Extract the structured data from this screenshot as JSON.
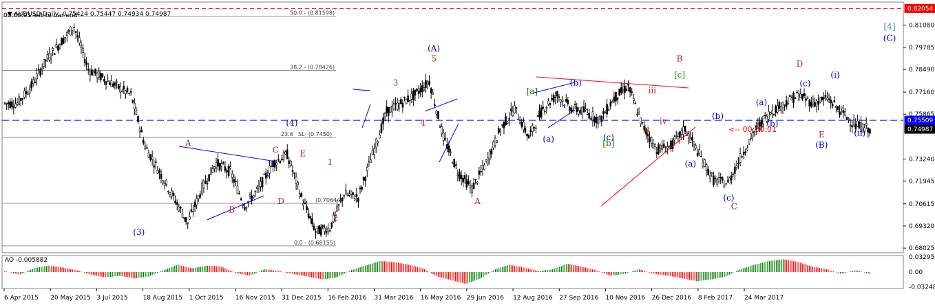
{
  "header": {
    "symbol_line": "AUDUSD,Daily  0.75424 0.75447 0.74934 0.74987",
    "bar_timer": "00:00:01 left to bar end"
  },
  "countdown": "<-- 00:00:01",
  "colors": {
    "bg": "#ffffff",
    "candle": "#000000",
    "grid": "#c0c0c0",
    "wave_red": "#b22222",
    "wave_blue": "#0000cc",
    "wave_green": "#008000",
    "wave_teal": "#2e8b8b",
    "ao_up": "#008000",
    "ao_down": "#ff0000",
    "price_tag": "#ff0000",
    "current_line": "#0000ff"
  },
  "chart_data": {
    "type": "candlestick",
    "symbol": "AUDUSD",
    "timeframe": "Daily",
    "ohlc_current": {
      "open": 0.75424,
      "high": 0.75447,
      "low": 0.74934,
      "close": 0.74987
    },
    "ylim": [
      0.6775,
      0.8243
    ],
    "y_ticks": [
      "0.82054",
      "0.81080",
      "0.79785",
      "0.78490",
      "0.77160",
      "0.75865",
      "0.75509",
      "0.74987",
      "0.73240",
      "0.71945",
      "0.70615",
      "0.69320",
      "0.68025"
    ],
    "price_tag_top": "0.82054",
    "current_price_tag": "0.75509",
    "last_price_tag": "0.74987",
    "current_price_line": 0.75509,
    "resistance_line": 0.82054,
    "x_dates": [
      "6 Apr 2015",
      "20 May 2015",
      "3 Jul 2015",
      "18 Aug 2015",
      "1 Oct 2015",
      "16 Nov 2015",
      "31 Dec 2015",
      "16 Feb 2016",
      "31 Mar 2016",
      "16 May 2016",
      "29 Jun 2016",
      "12 Aug 2016",
      "27 Sep 2016",
      "10 Nov 2016",
      "26 Dec 2016",
      "8 Feb 2017",
      "24 Mar 2017"
    ],
    "close_path": [
      [
        0.76,
        0.77,
        0.765
      ],
      [
        0.77,
        0.78,
        0.775
      ],
      [
        0.785,
        0.795,
        0.79
      ],
      [
        0.795,
        0.805,
        0.8
      ],
      [
        0.805,
        0.8163,
        0.81
      ],
      [
        0.79,
        0.8,
        0.785
      ],
      [
        0.775,
        0.785,
        0.78
      ],
      [
        0.77,
        0.78,
        0.775
      ],
      [
        0.765,
        0.778,
        0.77
      ],
      [
        0.745,
        0.755,
        0.74
      ],
      [
        0.73,
        0.738,
        0.725
      ],
      [
        0.715,
        0.725,
        0.71
      ],
      [
        0.695,
        0.705,
        0.695
      ],
      [
        0.7,
        0.71,
        0.715
      ],
      [
        0.72,
        0.73,
        0.73
      ],
      [
        0.73,
        0.74,
        0.725
      ],
      [
        0.715,
        0.725,
        0.705
      ],
      [
        0.7,
        0.71,
        0.715
      ],
      [
        0.72,
        0.73,
        0.73
      ],
      [
        0.725,
        0.74,
        0.735
      ],
      [
        0.715,
        0.725,
        0.71
      ],
      [
        0.695,
        0.705,
        0.69
      ],
      [
        0.685,
        0.695,
        0.692
      ],
      [
        0.7,
        0.71,
        0.712
      ],
      [
        0.705,
        0.715,
        0.71
      ],
      [
        0.72,
        0.73,
        0.735
      ],
      [
        0.75,
        0.76,
        0.76
      ],
      [
        0.77,
        0.78,
        0.765
      ],
      [
        0.76,
        0.77,
        0.77
      ],
      [
        0.78,
        0.785,
        0.778
      ],
      [
        0.75,
        0.76,
        0.745
      ],
      [
        0.73,
        0.74,
        0.725
      ],
      [
        0.72,
        0.73,
        0.715
      ],
      [
        0.725,
        0.735,
        0.73
      ],
      [
        0.745,
        0.755,
        0.75
      ],
      [
        0.76,
        0.77,
        0.762
      ],
      [
        0.75,
        0.76,
        0.745
      ],
      [
        0.755,
        0.765,
        0.762
      ],
      [
        0.77,
        0.777,
        0.77
      ],
      [
        0.76,
        0.77,
        0.762
      ],
      [
        0.765,
        0.775,
        0.76
      ],
      [
        0.755,
        0.765,
        0.755
      ],
      [
        0.76,
        0.77,
        0.768
      ],
      [
        0.77,
        0.78,
        0.775
      ],
      [
        0.755,
        0.765,
        0.752
      ],
      [
        0.74,
        0.75,
        0.738
      ],
      [
        0.735,
        0.745,
        0.74
      ],
      [
        0.745,
        0.755,
        0.75
      ],
      [
        0.74,
        0.75,
        0.735
      ],
      [
        0.725,
        0.735,
        0.72
      ],
      [
        0.715,
        0.725,
        0.718
      ],
      [
        0.725,
        0.735,
        0.735
      ],
      [
        0.745,
        0.755,
        0.75
      ],
      [
        0.755,
        0.765,
        0.76
      ],
      [
        0.76,
        0.77,
        0.765
      ],
      [
        0.765,
        0.775,
        0.77
      ],
      [
        0.762,
        0.772,
        0.765
      ],
      [
        0.77,
        0.78,
        0.768
      ],
      [
        0.765,
        0.775,
        0.76
      ],
      [
        0.755,
        0.762,
        0.752
      ],
      [
        0.758,
        0.765,
        0.75
      ]
    ],
    "fib_levels": [
      {
        "label": "50.0 - (0.81598)",
        "value": 0.81598
      },
      {
        "label": "38.2 - (0.78426)",
        "value": 0.78426
      },
      {
        "label": "23.6",
        "value": 0.745
      },
      {
        "label": "SL- (0.7450)",
        "value": 0.745
      },
      {
        "label": "(0.70644)",
        "value": 0.70644
      },
      {
        "label": "0.0 - (0.68155)",
        "value": 0.68155
      }
    ],
    "wave_labels": [
      {
        "text": "(A)",
        "color": "blue",
        "date_index": 8.6,
        "price": 0.7955
      },
      {
        "text": "5",
        "color": "red",
        "date_index": 8.6,
        "price": 0.7895
      },
      {
        "text": "3",
        "color": "red",
        "date_index": 7.9,
        "price": 0.7755
      },
      {
        "text": "4",
        "color": "red",
        "date_index": 8.4,
        "price": 0.752
      },
      {
        "text": "1",
        "color": "red",
        "date_index": 6.7,
        "price": 0.729
      },
      {
        "text": "2",
        "color": "red",
        "date_index": 6.8,
        "price": 0.6965
      },
      {
        "text": "(4)",
        "color": "blue",
        "date_index": 6.0,
        "price": 0.752
      },
      {
        "text": "(3)",
        "color": "blue",
        "date_index": 3.2,
        "price": 0.688
      },
      {
        "text": "A",
        "color": "red",
        "date_index": 4.1,
        "price": 0.74
      },
      {
        "text": "B",
        "color": "red",
        "date_index": 4.9,
        "price": 0.701
      },
      {
        "text": "C",
        "color": "red",
        "date_index": 5.7,
        "price": 0.736
      },
      {
        "text": "D",
        "color": "red",
        "date_index": 5.8,
        "price": 0.706
      },
      {
        "text": "E",
        "color": "red",
        "date_index": 6.2,
        "price": 0.734
      },
      {
        "text": "A",
        "color": "red",
        "date_index": 9.4,
        "price": 0.706
      },
      {
        "text": "[a]",
        "color": "green",
        "date_index": 10.4,
        "price": 0.7705
      },
      {
        "text": "(a)",
        "color": "blue",
        "date_index": 10.7,
        "price": 0.7425
      },
      {
        "text": "(b)",
        "color": "blue",
        "date_index": 11.2,
        "price": 0.7755
      },
      {
        "text": "(c)",
        "color": "blue",
        "date_index": 11.8,
        "price": 0.7435
      },
      {
        "text": "[b]",
        "color": "green",
        "date_index": 11.8,
        "price": 0.74
      },
      {
        "text": "B",
        "color": "red",
        "date_index": 13.1,
        "price": 0.7895
      },
      {
        "text": "[c]",
        "color": "green",
        "date_index": 13.1,
        "price": 0.78
      },
      {
        "text": "iii",
        "color": "red",
        "date_index": 12.6,
        "price": 0.771
      },
      {
        "text": "iv",
        "color": "red",
        "date_index": 12.8,
        "price": 0.753
      },
      {
        "text": "ii",
        "color": "red",
        "date_index": 12.5,
        "price": 0.7485
      },
      {
        "text": "(a)",
        "color": "blue",
        "date_index": 13.3,
        "price": 0.728
      },
      {
        "text": "(b)",
        "color": "blue",
        "date_index": 13.8,
        "price": 0.756
      },
      {
        "text": "(c)",
        "color": "blue",
        "date_index": 14.0,
        "price": 0.708
      },
      {
        "text": "C",
        "color": "red",
        "date_index": 14.1,
        "price": 0.703
      },
      {
        "text": "(a)",
        "color": "blue",
        "date_index": 14.6,
        "price": 0.764
      },
      {
        "text": "(b)",
        "color": "blue",
        "date_index": 14.8,
        "price": 0.7515
      },
      {
        "text": "D",
        "color": "red",
        "date_index": 15.3,
        "price": 0.7865
      },
      {
        "text": "(c)",
        "color": "blue",
        "date_index": 15.4,
        "price": 0.775
      },
      {
        "text": "E",
        "color": "red",
        "date_index": 15.7,
        "price": 0.745
      },
      {
        "text": "(B)",
        "color": "blue",
        "date_index": 15.7,
        "price": 0.739
      },
      {
        "text": "(i)",
        "color": "blue",
        "date_index": 15.95,
        "price": 0.78
      },
      {
        "text": "(ii)",
        "color": "blue",
        "date_index": 16.4,
        "price": 0.746
      },
      {
        "text": "[4]",
        "color": "teal",
        "date_index": 16.95,
        "price": 0.8085
      },
      {
        "text": "(C)",
        "color": "blue",
        "date_index": 16.95,
        "price": 0.8015
      }
    ],
    "ao": {
      "label": "AO -0.005882",
      "y_ticks": [
        "0.032954",
        "0.00",
        "-0.032482"
      ],
      "ylim": [
        -0.036,
        0.036
      ],
      "values": [
        0.002,
        -0.006,
        0.008,
        0.014,
        0.01,
        0.004,
        -0.006,
        -0.012,
        -0.008,
        -0.014,
        -0.01,
        0.004,
        0.016,
        0.008,
        0.014,
        0.012,
        -0.002,
        -0.008,
        0.006,
        0.002,
        -0.004,
        -0.01,
        -0.016,
        -0.012,
        0.004,
        0.014,
        0.024,
        0.022,
        0.016,
        0.008,
        -0.01,
        -0.018,
        -0.026,
        -0.014,
        0.006,
        0.016,
        0.01,
        0.002,
        0.006,
        0.018,
        0.012,
        0.004,
        -0.008,
        -0.004,
        0.006,
        -0.004,
        -0.008,
        -0.014,
        -0.02,
        -0.016,
        -0.01,
        0.006,
        0.016,
        0.024,
        0.028,
        0.022,
        0.012,
        0.006,
        -0.004,
        0.004,
        -0.004
      ]
    }
  }
}
